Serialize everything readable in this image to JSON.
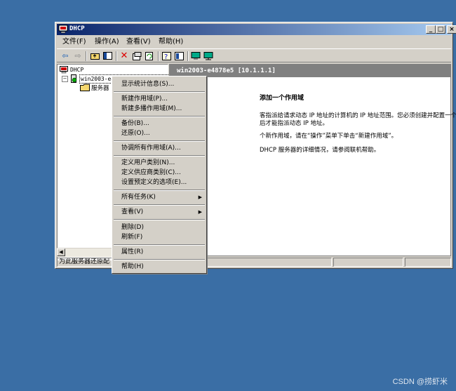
{
  "window": {
    "title": "DHCP",
    "minimize": "_",
    "maximize": "□",
    "close": "×"
  },
  "menubar": [
    "文件(F)",
    "操作(A)",
    "查看(V)",
    "帮助(H)"
  ],
  "toolbar_icons": [
    "back-arrow-icon",
    "forward-arrow-icon",
    "up-folder-icon",
    "show-tree-icon",
    "delete-icon",
    "properties-icon",
    "refresh-icon",
    "help-icon",
    "console-icon",
    "monitor-icon",
    "monitor-net-icon"
  ],
  "tree": {
    "root": "DHCP",
    "server": "win2003-e4878e5 [10.1.1.1]",
    "child": "服务器"
  },
  "right_header": "win2003-e4878e5 [10.1.1.1]",
  "right_content": {
    "heading": "添加一个作用域",
    "line1": "客指派给请求动态 IP 地址的计算机的 IP 地址范围。您必须创建并配置一个",
    "line2": "后才能指派动态 IP 地址。",
    "line3": "个新作用域，请在“操作”菜单下单击“新建作用域”。",
    "line4": "DHCP 服务器的详细情况，请参阅联机帮助。"
  },
  "statusbar": {
    "text": "为此服务器还原配"
  },
  "context_menu": {
    "items": [
      {
        "label": "显示统计信息(S)..."
      },
      {
        "label": "新建作用域(P)..."
      },
      {
        "label": "新建多播作用域(M)..."
      },
      {
        "label": "备份(B)..."
      },
      {
        "label": "还原(O)..."
      },
      {
        "label": "协调所有作用域(A)..."
      },
      {
        "label": "定义用户类别(N)..."
      },
      {
        "label": "定义供应商类别(C)..."
      },
      {
        "label": "设置预定义的选项(E)..."
      },
      {
        "label": "所有任务(K)"
      },
      {
        "label": "查看(V)"
      },
      {
        "label": "删除(D)"
      },
      {
        "label": "刷新(F)"
      },
      {
        "label": "属性(R)"
      },
      {
        "label": "帮助(H)"
      }
    ],
    "submenu_arrow": "▶"
  },
  "watermark": "CSDN @捞虾米"
}
